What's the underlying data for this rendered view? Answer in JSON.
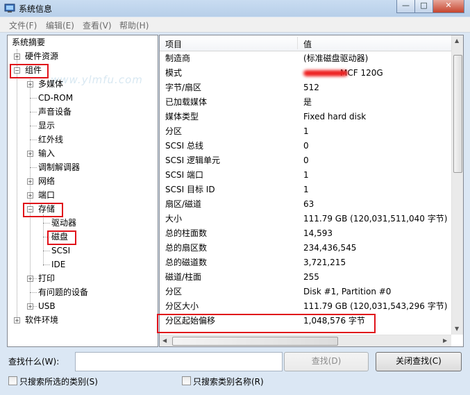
{
  "window": {
    "title": "系统信息",
    "controls": {
      "minimize": "—",
      "maximize": "□",
      "close": "✕"
    }
  },
  "menu": [
    "文件(F)",
    "编辑(E)",
    "查看(V)",
    "帮助(H)"
  ],
  "watermark": "www.ylmfu.com",
  "tree": {
    "root": "系统摘要",
    "hardware": "硬件资源",
    "components": "组件",
    "multimedia": "多媒体",
    "cdrom": "CD-ROM",
    "sound": "声音设备",
    "display": "显示",
    "infrared": "红外线",
    "input": "输入",
    "modem": "调制解调器",
    "network": "网络",
    "ports": "端口",
    "storage": "存储",
    "drives": "驱动器",
    "disks": "磁盘",
    "scsi": "SCSI",
    "ide": "IDE",
    "printing": "打印",
    "problem_devices": "有问题的设备",
    "usb": "USB",
    "software": "软件环境"
  },
  "details": {
    "col_item": "项目",
    "col_value": "值",
    "rows": [
      {
        "k": "制造商",
        "v": "(标准磁盘驱动器)"
      },
      {
        "k": "模式",
        "v": "MCF 120G"
      },
      {
        "k": "字节/扇区",
        "v": "512"
      },
      {
        "k": "已加载媒体",
        "v": "是"
      },
      {
        "k": "媒体类型",
        "v": "Fixed hard disk"
      },
      {
        "k": "分区",
        "v": "1"
      },
      {
        "k": "SCSI 总线",
        "v": "0"
      },
      {
        "k": "SCSI 逻辑单元",
        "v": "0"
      },
      {
        "k": "SCSI 端口",
        "v": "1"
      },
      {
        "k": "SCSI 目标 ID",
        "v": "1"
      },
      {
        "k": "扇区/磁道",
        "v": "63"
      },
      {
        "k": "大小",
        "v": "111.79 GB (120,031,511,040 字节)"
      },
      {
        "k": "总的柱面数",
        "v": "14,593"
      },
      {
        "k": "总的扇区数",
        "v": "234,436,545"
      },
      {
        "k": "总的磁道数",
        "v": "3,721,215"
      },
      {
        "k": "磁道/柱面",
        "v": "255"
      },
      {
        "k": "分区",
        "v": "Disk #1, Partition #0"
      },
      {
        "k": "分区大小",
        "v": "111.79 GB (120,031,543,296 字节)"
      },
      {
        "k": "分区起始偏移",
        "v": "1,048,576 字节"
      }
    ]
  },
  "find": {
    "label": "查找什么(W):",
    "value": "",
    "find_button": "查找(D)",
    "close_button": "关闭查找(C)",
    "check_selected": "只搜索所选的类别(S)",
    "check_names": "只搜索类别名称(R)"
  },
  "colors": {
    "highlight_border": "#e0121a",
    "window_bg": "#dbe7f4"
  }
}
